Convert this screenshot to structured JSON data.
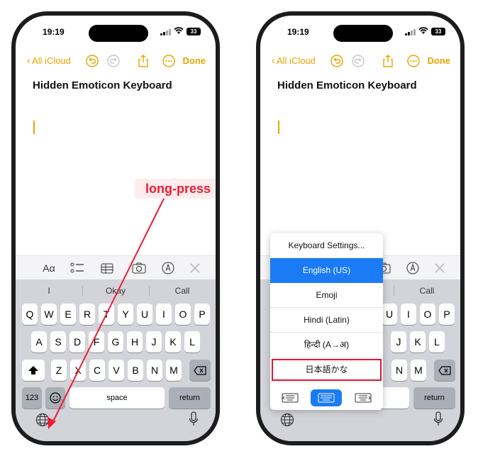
{
  "status": {
    "time": "19:19",
    "battery": "33"
  },
  "nav": {
    "back_label": "All iCloud",
    "done_label": "Done"
  },
  "note": {
    "title": "Hidden Emoticon Keyboard"
  },
  "toolbar": {
    "format_label": "Aα"
  },
  "suggestions": [
    "I",
    "Okay",
    "Call"
  ],
  "keys": {
    "row1": [
      "Q",
      "W",
      "E",
      "R",
      "T",
      "Y",
      "U",
      "I",
      "O",
      "P"
    ],
    "row2": [
      "A",
      "S",
      "D",
      "F",
      "G",
      "H",
      "J",
      "K",
      "L"
    ],
    "row3": [
      "Z",
      "X",
      "C",
      "V",
      "B",
      "N",
      "M"
    ],
    "numbers_label": "123",
    "space_label": "space",
    "return_label": "return"
  },
  "annotation": {
    "label": "long-press",
    "color": "#ee1c34"
  },
  "language_menu": {
    "items": [
      "Keyboard Settings...",
      "English (US)",
      "Emoji",
      "Hindi (Latin)",
      "हिन्दी (A→अ)",
      "日本語かな"
    ],
    "selected_index": 1,
    "highlighted_index": 5
  },
  "colors": {
    "accent": "#e9a400",
    "selection": "#1a7bf5",
    "annotation": "#ee1c34"
  }
}
